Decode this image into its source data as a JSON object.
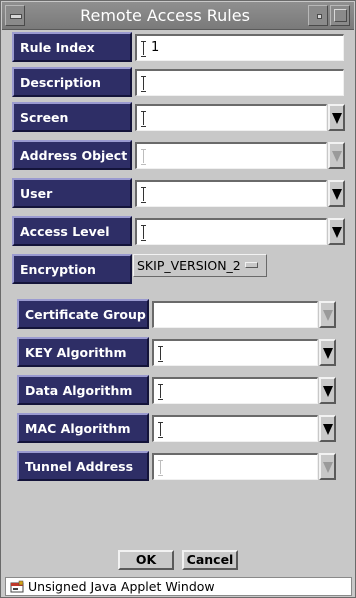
{
  "window": {
    "title": "Remote Access Rules"
  },
  "fields": [
    {
      "label": "Rule Index",
      "value": "1"
    },
    {
      "label": "Description",
      "value": ""
    },
    {
      "label": "Screen",
      "value": ""
    },
    {
      "label": "Address Object",
      "value": ""
    },
    {
      "label": "User",
      "value": ""
    },
    {
      "label": "Access Level",
      "value": ""
    }
  ],
  "encryption": {
    "label": "Encryption",
    "selected": "SKIP_VERSION_2"
  },
  "skip_fields": [
    {
      "label": "Certificate Group",
      "value": ""
    },
    {
      "label": "KEY Algorithm",
      "value": ""
    },
    {
      "label": "Data Algorithm",
      "value": ""
    },
    {
      "label": "MAC Algorithm",
      "value": ""
    },
    {
      "label": "Tunnel Address",
      "value": ""
    }
  ],
  "buttons": {
    "ok": "OK",
    "cancel": "Cancel"
  },
  "status": {
    "text": "Unsigned Java Applet Window"
  },
  "colors": {
    "label_bg": "#2e2e66",
    "window_bg": "#c8c8c8",
    "title_bg": "#858585"
  }
}
